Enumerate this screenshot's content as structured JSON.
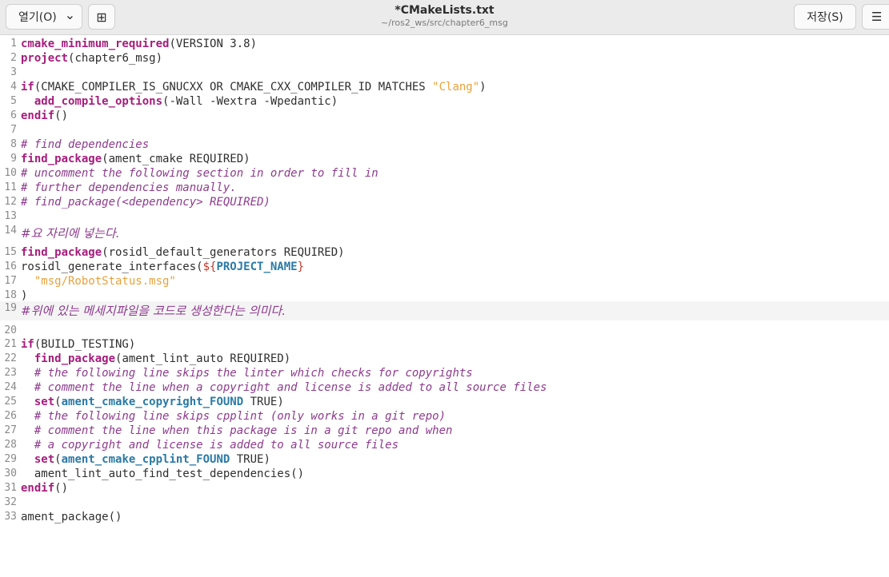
{
  "header": {
    "open_label": "열기(O)",
    "open_chevron": "⌄",
    "newtab_icon": "⊞",
    "title": "*CMakeLists.txt",
    "subtitle": "~/ros2_ws/src/chapter6_msg",
    "save_label": "저장(S)",
    "menu_icon": "☰"
  },
  "editor": {
    "current_line": 19,
    "lines": [
      {
        "n": "1",
        "parts": [
          [
            "kw",
            "cmake_minimum_required"
          ],
          [
            "",
            "(VERSION 3.8)"
          ]
        ]
      },
      {
        "n": "2",
        "parts": [
          [
            "kw",
            "project"
          ],
          [
            "",
            "(chapter6_msg)"
          ]
        ]
      },
      {
        "n": "3",
        "parts": []
      },
      {
        "n": "4",
        "parts": [
          [
            "kw",
            "if"
          ],
          [
            "",
            "(CMAKE_COMPILER_IS_GNUCXX OR CMAKE_CXX_COMPILER_ID MATCHES "
          ],
          [
            "str",
            "\"Clang\""
          ],
          [
            "",
            ")"
          ]
        ]
      },
      {
        "n": "5",
        "parts": [
          [
            "",
            "  "
          ],
          [
            "kw",
            "add_compile_options"
          ],
          [
            "",
            "(-Wall -Wextra -Wpedantic)"
          ]
        ]
      },
      {
        "n": "6",
        "parts": [
          [
            "kw",
            "endif"
          ],
          [
            "",
            "()"
          ]
        ]
      },
      {
        "n": "7",
        "parts": []
      },
      {
        "n": "8",
        "parts": [
          [
            "cm",
            "# find dependencies"
          ]
        ]
      },
      {
        "n": "9",
        "parts": [
          [
            "kw",
            "find_package"
          ],
          [
            "",
            "(ament_cmake REQUIRED)"
          ]
        ]
      },
      {
        "n": "10",
        "parts": [
          [
            "cm",
            "# uncomment the following section in order to fill in"
          ]
        ]
      },
      {
        "n": "11",
        "parts": [
          [
            "cm",
            "# further dependencies manually."
          ]
        ]
      },
      {
        "n": "12",
        "parts": [
          [
            "cm",
            "# find_package(<dependency> REQUIRED)"
          ]
        ]
      },
      {
        "n": "13",
        "parts": []
      },
      {
        "n": "14",
        "hangul": true,
        "parts": [
          [
            "hcm",
            "#요 자리에 넣는다."
          ]
        ]
      },
      {
        "n": "15",
        "parts": [
          [
            "kw",
            "find_package"
          ],
          [
            "",
            "(rosidl_default_generators REQUIRED)"
          ]
        ]
      },
      {
        "n": "16",
        "parts": [
          [
            "",
            "rosidl_generate_interfaces("
          ],
          [
            "dollar",
            "${"
          ],
          [
            "var",
            "PROJECT_NAME"
          ],
          [
            "dollar",
            "}"
          ]
        ]
      },
      {
        "n": "17",
        "parts": [
          [
            "",
            "  "
          ],
          [
            "str",
            "\"msg/RobotStatus.msg\""
          ]
        ]
      },
      {
        "n": "18",
        "parts": [
          [
            "",
            ")"
          ]
        ]
      },
      {
        "n": "19",
        "hangul": true,
        "parts": [
          [
            "hcm",
            "#위에 있는 메세지파일을 코드로 생성한다는 의미다."
          ]
        ]
      },
      {
        "n": "20",
        "parts": []
      },
      {
        "n": "21",
        "parts": [
          [
            "kw",
            "if"
          ],
          [
            "",
            "(BUILD_TESTING)"
          ]
        ]
      },
      {
        "n": "22",
        "parts": [
          [
            "",
            "  "
          ],
          [
            "kw",
            "find_package"
          ],
          [
            "",
            "(ament_lint_auto REQUIRED)"
          ]
        ]
      },
      {
        "n": "23",
        "parts": [
          [
            "",
            "  "
          ],
          [
            "cm",
            "# the following line skips the linter which checks for copyrights"
          ]
        ]
      },
      {
        "n": "24",
        "parts": [
          [
            "",
            "  "
          ],
          [
            "cm",
            "# comment the line when a copyright and license is added to all source files"
          ]
        ]
      },
      {
        "n": "25",
        "parts": [
          [
            "",
            "  "
          ],
          [
            "kw",
            "set"
          ],
          [
            "",
            "("
          ],
          [
            "var",
            "ament_cmake_copyright_FOUND"
          ],
          [
            "",
            " TRUE)"
          ]
        ]
      },
      {
        "n": "26",
        "parts": [
          [
            "",
            "  "
          ],
          [
            "cm",
            "# the following line skips cpplint (only works in a git repo)"
          ]
        ]
      },
      {
        "n": "27",
        "parts": [
          [
            "",
            "  "
          ],
          [
            "cm",
            "# comment the line when this package is in a git repo and when"
          ]
        ]
      },
      {
        "n": "28",
        "parts": [
          [
            "",
            "  "
          ],
          [
            "cm",
            "# a copyright and license is added to all source files"
          ]
        ]
      },
      {
        "n": "29",
        "parts": [
          [
            "",
            "  "
          ],
          [
            "kw",
            "set"
          ],
          [
            "",
            "("
          ],
          [
            "var",
            "ament_cmake_cpplint_FOUND"
          ],
          [
            "",
            " TRUE)"
          ]
        ]
      },
      {
        "n": "30",
        "parts": [
          [
            "",
            "  ament_lint_auto_find_test_dependencies()"
          ]
        ]
      },
      {
        "n": "31",
        "parts": [
          [
            "kw",
            "endif"
          ],
          [
            "",
            "()"
          ]
        ]
      },
      {
        "n": "32",
        "parts": []
      },
      {
        "n": "33",
        "parts": [
          [
            "",
            "ament_package()"
          ]
        ]
      }
    ]
  }
}
